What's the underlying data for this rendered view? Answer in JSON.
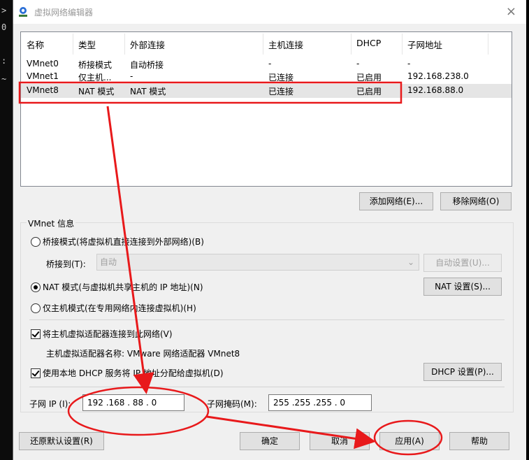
{
  "terminal": {
    "lines": [
      ">",
      "0",
      ":",
      "~"
    ]
  },
  "window": {
    "title": "虚拟网络编辑器",
    "close": "×"
  },
  "netlist": {
    "headers": [
      "名称",
      "类型",
      "外部连接",
      "主机连接",
      "DHCP",
      "子网地址"
    ],
    "rows": [
      {
        "name": "VMnet0",
        "type": "桥接模式",
        "external": "自动桥接",
        "host": "-",
        "dhcp": "-",
        "subnet": "-"
      },
      {
        "name": "VMnet1",
        "type": "仅主机...",
        "external": "-",
        "host": "已连接",
        "dhcp": "已启用",
        "subnet": "192.168.238.0"
      },
      {
        "name": "VMnet8",
        "type": "NAT 模式",
        "external": "NAT 模式",
        "host": "已连接",
        "dhcp": "已启用",
        "subnet": "192.168.88.0"
      }
    ]
  },
  "buttons": {
    "add_network": "添加网络(E)...",
    "remove_network": "移除网络(O)",
    "auto_settings": "自动设置(U)...",
    "nat_settings": "NAT 设置(S)...",
    "dhcp_settings": "DHCP 设置(P)...",
    "restore_defaults": "还原默认设置(R)",
    "ok": "确定",
    "cancel": "取消",
    "apply": "应用(A)",
    "help": "帮助"
  },
  "info": {
    "title": "VMnet 信息",
    "bridged_label": "桥接模式(将虚拟机直接连接到外部网络)(B)",
    "bridge_to_label": "桥接到(T):",
    "bridge_to_value": "自动",
    "nat_label": "NAT 模式(与虚拟机共享主机的 IP 地址)(N)",
    "hostonly_label": "仅主机模式(在专用网络内连接虚拟机)(H)",
    "connect_adapter_label": "将主机虚拟适配器连接到此网络(V)",
    "adapter_name_label": "主机虚拟适配器名称: VMware 网络适配器 VMnet8",
    "use_dhcp_label": "使用本地 DHCP 服务将 IP 地址分配给虚拟机(D)",
    "subnet_ip_label": "子网 IP (I):",
    "subnet_ip_value": "192 .168 . 88 . 0",
    "subnet_mask_label": "子网掩码(M):",
    "subnet_mask_value": "255 .255 .255 . 0"
  },
  "annotation": {
    "color": "#e8191b"
  }
}
